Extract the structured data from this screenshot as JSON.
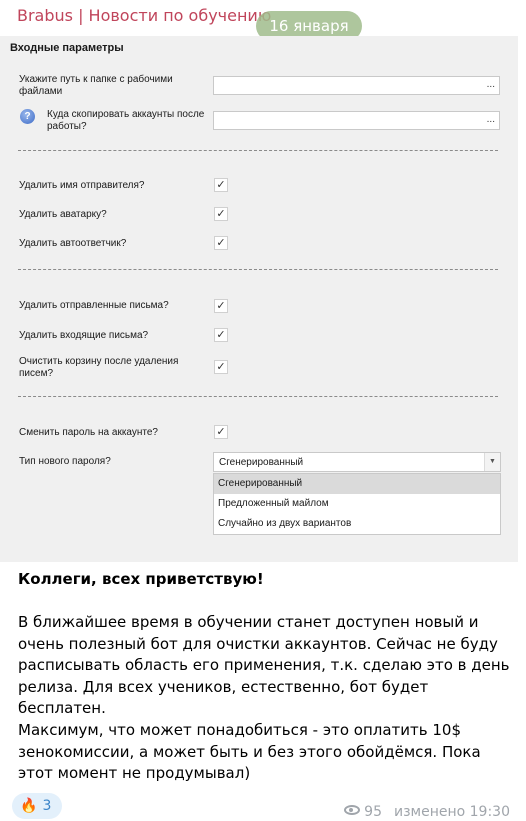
{
  "header": {
    "channel": "Brabus | Новости по обучению",
    "date": "16 января"
  },
  "form": {
    "section_title": "Входные параметры",
    "work_folder_label": "Укажите путь к папке с рабочими файлами",
    "copy_accounts_label": "Куда скопировать аккаунты после работы?",
    "help_symbol": "?",
    "browse_label": "...",
    "checkbox_mark": "✓",
    "delete_sender_name": "Удалить имя отправителя?",
    "delete_avatar": "Удалить аватарку?",
    "delete_autoresponder": "Удалить автоответчик?",
    "delete_sent": "Удалить отправленные письма?",
    "delete_inbox": "Удалить входящие письма?",
    "empty_trash": "Очистить корзину после удаления писем?",
    "change_password": "Сменить пароль на аккаунте?",
    "password_type_label": "Тип нового пароля?",
    "password_type_value": "Сгенерированный",
    "password_options": [
      "Сгенерированный",
      "Предложенный майлом",
      "Случайно из двух вариантов"
    ]
  },
  "message": {
    "greeting": "Коллеги, всех приветствую!",
    "paragraph1": "В ближайшее время в обучении станет доступен новый и очень полезный бот для очистки аккаунтов. Сейчас не буду расписывать область его применения, т.к. сделаю это в день релиза. Для всех учеников, естественно, бот будет бесплатен.",
    "paragraph2": "Максимум, что может понадобиться - это оплатить 10$ зенокомиссии, а может быть и без этого обойдёмся. Пока этот момент не продумывал)"
  },
  "footer": {
    "reaction_emoji": "🔥",
    "reaction_count": "3",
    "views": "95",
    "edited": "изменено 19:30"
  },
  "colors": {
    "channel_title": "#c0455b",
    "date_pill": "#a0bc8c",
    "reaction_bg": "#e3f0fb"
  }
}
